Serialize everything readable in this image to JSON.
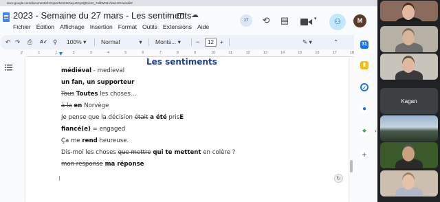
{
  "browser": {
    "url": "docs.google.com/document/d/1YopaVNmlHsOayu0Gy6Ql5VoG_7uldWt11Vlvw1zOHw/edit#"
  },
  "docs": {
    "title": "2023 - Semaine du 27 mars - Les sentiments",
    "menu": [
      "Fichier",
      "Édition",
      "Affichage",
      "Insertion",
      "Format",
      "Outils",
      "Extensions",
      "Aide"
    ],
    "comment_badge": "17",
    "avatar_letter": "M",
    "toolbar": {
      "zoom": "100%",
      "style": "Normal",
      "font": "Monts...",
      "font_size": "12"
    },
    "ruler": [
      "2",
      "1",
      "1",
      "2",
      "3",
      "4",
      "5",
      "6",
      "7",
      "8",
      "9",
      "10",
      "11",
      "12",
      "13",
      "14",
      "15",
      "16",
      "17",
      "18"
    ]
  },
  "document": {
    "heading": "Les sentiments",
    "lines": [
      {
        "parts": [
          {
            "t": "médiéval",
            "b": true
          },
          {
            "t": " - medieval"
          }
        ]
      },
      {
        "parts": [
          {
            "t": "un fan, un supporteur",
            "b": true
          }
        ]
      },
      {
        "parts": [
          {
            "t": "Tous",
            "s": true
          },
          {
            "t": " "
          },
          {
            "t": "Toutes",
            "b": true
          },
          {
            "t": " les choses..."
          }
        ]
      },
      {
        "parts": [
          {
            "t": "à la",
            "s": true
          },
          {
            "t": " "
          },
          {
            "t": "en",
            "b": true
          },
          {
            "t": " Norvège"
          }
        ]
      },
      {
        "parts": [
          {
            "t": "Je pense que la décision "
          },
          {
            "t": "était",
            "s": true
          },
          {
            "t": " "
          },
          {
            "t": "a été",
            "b": true
          },
          {
            "t": " pris"
          },
          {
            "t": "E",
            "b": true
          }
        ]
      },
      {
        "parts": [
          {
            "t": "fiancé(e)",
            "b": true
          },
          {
            "t": " = engaged"
          }
        ]
      },
      {
        "parts": [
          {
            "t": "Ça me "
          },
          {
            "t": "rend",
            "b": true
          },
          {
            "t": " heureuse."
          }
        ]
      },
      {
        "parts": [
          {
            "t": "Dis-moi les choses "
          },
          {
            "t": "que mettre",
            "s": true
          },
          {
            "t": " "
          },
          {
            "t": "qui te mettent",
            "b": true
          },
          {
            "t": " en colère ?"
          }
        ]
      },
      {
        "parts": [
          {
            "t": "mon response",
            "s": true
          },
          {
            "t": " "
          },
          {
            "t": "ma réponse",
            "b": true
          }
        ]
      }
    ]
  },
  "participants": [
    {
      "name": "",
      "bg": "#8a6a5a",
      "skin": "#e2b8a0",
      "hair": "#4a2a1a",
      "shirt": "#1a1a1a",
      "active": true
    },
    {
      "name": "",
      "bg": "#b7b0a4",
      "skin": "#d8b59a",
      "hair": "#7a6a5a",
      "shirt": "#6e6e6e",
      "active": false
    },
    {
      "name": "",
      "bg": "#c8c4bc",
      "skin": "#e0b8a0",
      "hair": "#5a4a3a",
      "shirt": "#3a3a3a",
      "active": false
    },
    {
      "name": "Kagan",
      "bg": "#3c4043",
      "skin": "",
      "hair": "",
      "shirt": "",
      "active": false
    },
    {
      "name": "",
      "bg": "#6e8aa8",
      "skin": "",
      "hair": "",
      "shirt": "",
      "active": false
    },
    {
      "name": "",
      "bg": "#3a5a2a",
      "skin": "#c9a080",
      "hair": "#555",
      "shirt": "#2a2a2a",
      "active": false
    },
    {
      "name": "",
      "bg": "#cdbfb0",
      "skin": "#e6c2a8",
      "hair": "#a08060",
      "shirt": "#b0b8c8",
      "active": false
    }
  ]
}
